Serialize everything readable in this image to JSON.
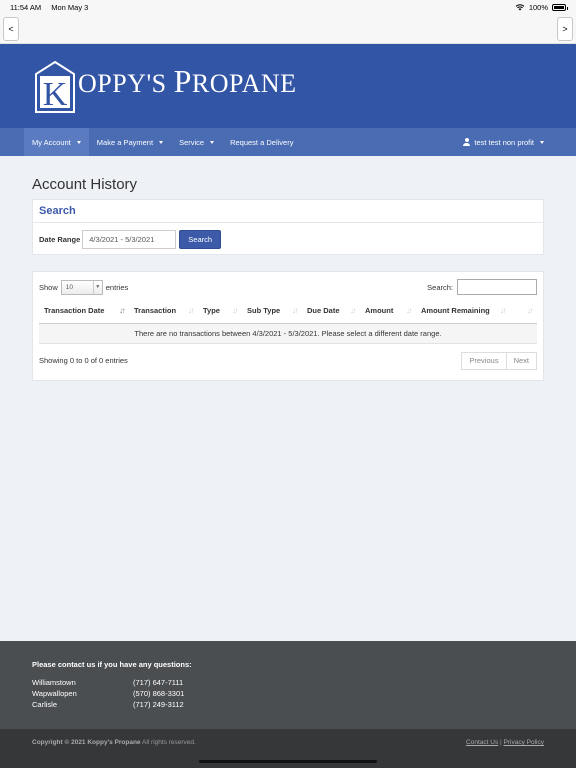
{
  "status": {
    "time": "11:54 AM",
    "date": "Mon May 3",
    "battery": "100%"
  },
  "browser": {
    "back": "<",
    "forward": ">"
  },
  "brand": {
    "initial": "K",
    "name_first_big": "K",
    "name_rest": "OPPY'S ",
    "name2_big": "P",
    "name2_rest": "ROPANE"
  },
  "nav": {
    "items": [
      {
        "label": "My Account",
        "dropdown": true
      },
      {
        "label": "Make a Payment",
        "dropdown": true
      },
      {
        "label": "Service",
        "dropdown": true
      },
      {
        "label": "Request a Delivery",
        "dropdown": false
      }
    ],
    "user": "test test non profit"
  },
  "page": {
    "title": "Account History"
  },
  "search": {
    "heading": "Search",
    "date_label": "Date Range",
    "date_value": "4/3/2021 - 5/3/2021",
    "button": "Search"
  },
  "table": {
    "show_label": "Show",
    "entries_value": "10",
    "entries_label": "entries",
    "search_label": "Search:",
    "columns": [
      "Transaction Date",
      "Transaction",
      "Type",
      "Sub Type",
      "Due Date",
      "Amount",
      "Amount Remaining",
      ""
    ],
    "empty_message": "There are no transactions between 4/3/2021 - 5/3/2021. Please select a different date range.",
    "info": "Showing 0 to 0 of 0 entries",
    "prev": "Previous",
    "next": "Next"
  },
  "footer": {
    "contact_title": "Please contact us if you have any questions:",
    "locations": [
      {
        "name": "Williamstown",
        "phone": "(717) 647-7111"
      },
      {
        "name": "Wapwallopen",
        "phone": "(570) 868-3301"
      },
      {
        "name": "Carlisle",
        "phone": "(717) 249-3112"
      }
    ],
    "copyright_bold": "Copyright © 2021 Koppy's Propane",
    "copyright_rest": " All rights reserved.",
    "contact_link": "Contact Us",
    "separator": "|",
    "privacy_link": "Privacy Policy"
  },
  "colors": {
    "brand": "#3355a5",
    "nav": "#4a6cb3",
    "accent": "#3d5aa8",
    "footer": "#4b4e51"
  }
}
